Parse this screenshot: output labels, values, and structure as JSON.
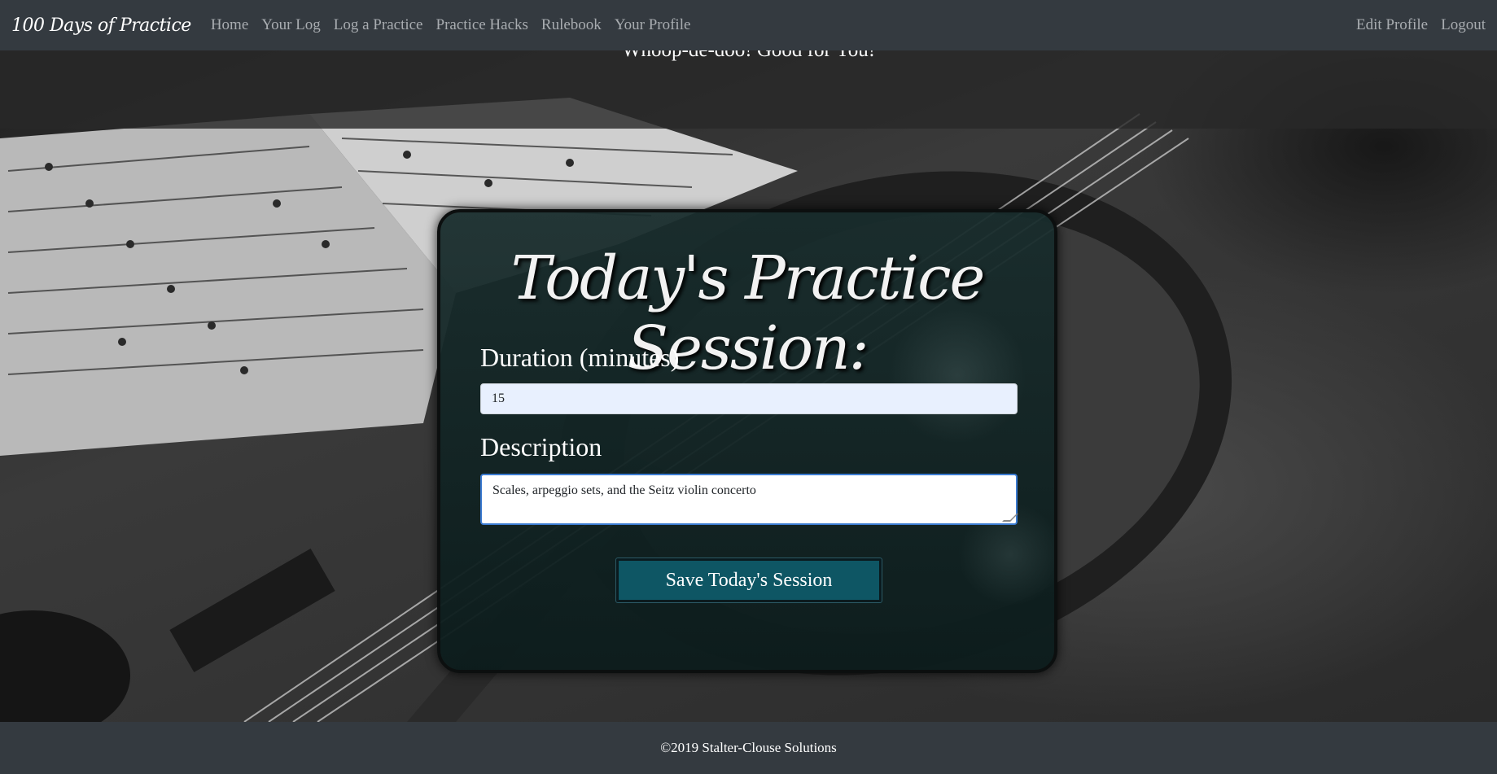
{
  "navbar": {
    "brand": "100 Days of Practice",
    "links": [
      "Home",
      "Your Log",
      "Log a Practice",
      "Practice Hacks",
      "Rulebook",
      "Your Profile"
    ],
    "right_links": [
      "Edit Profile",
      "Logout"
    ]
  },
  "alert": {
    "message": "Whoop-de-doo! Good for You!"
  },
  "form": {
    "title": "Today's Practice Session:",
    "duration_label": "Duration (minutes)",
    "duration_value": "15",
    "description_label": "Description",
    "description_value": "Scales, arpeggio sets, and the Seitz violin concerto",
    "save_label": "Save Today's Session"
  },
  "footer": {
    "text": "©2019 Stalter-Clouse Solutions"
  },
  "colors": {
    "navbar": "#343a40",
    "button": "#0e5664",
    "card": "#14302f"
  }
}
